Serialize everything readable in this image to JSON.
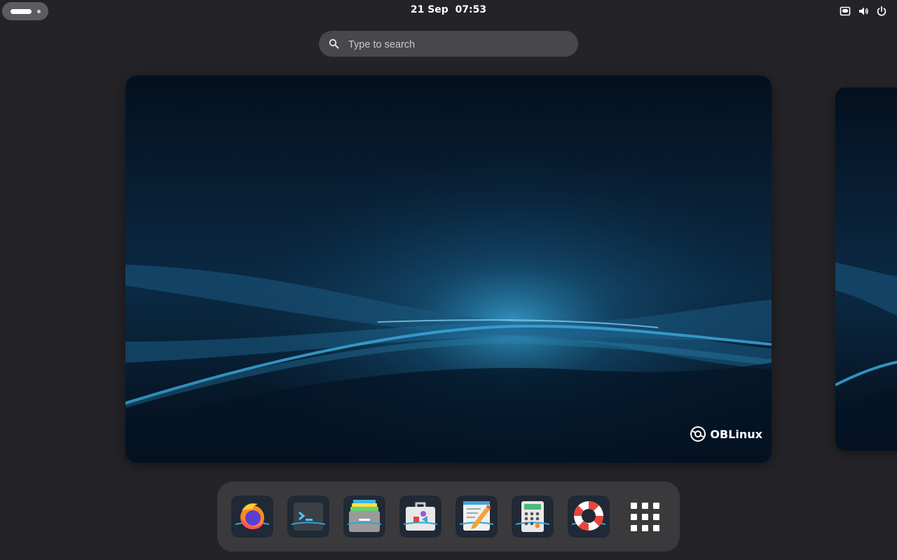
{
  "topbar": {
    "clock": "21 Sep  07:53",
    "tray_icons": [
      "network-wired-icon",
      "volume-icon",
      "power-icon"
    ]
  },
  "search": {
    "placeholder": "Type to search"
  },
  "workspace": {
    "brand_text": "OBLinux"
  },
  "dash": {
    "apps": [
      {
        "name": "Firefox",
        "icon": "firefox-icon"
      },
      {
        "name": "Terminal",
        "icon": "terminal-icon"
      },
      {
        "name": "Files",
        "icon": "files-icon"
      },
      {
        "name": "Software",
        "icon": "software-icon"
      },
      {
        "name": "Text Editor",
        "icon": "text-editor-icon"
      },
      {
        "name": "Calculator",
        "icon": "calculator-icon"
      },
      {
        "name": "Help",
        "icon": "help-icon"
      }
    ],
    "show_apps_icon": "app-grid-icon"
  },
  "colors": {
    "panel": "#242428",
    "search_bg": "#48484c",
    "dash_bg": "#3a3a3d",
    "accent_wave": "#2fa4d6"
  }
}
